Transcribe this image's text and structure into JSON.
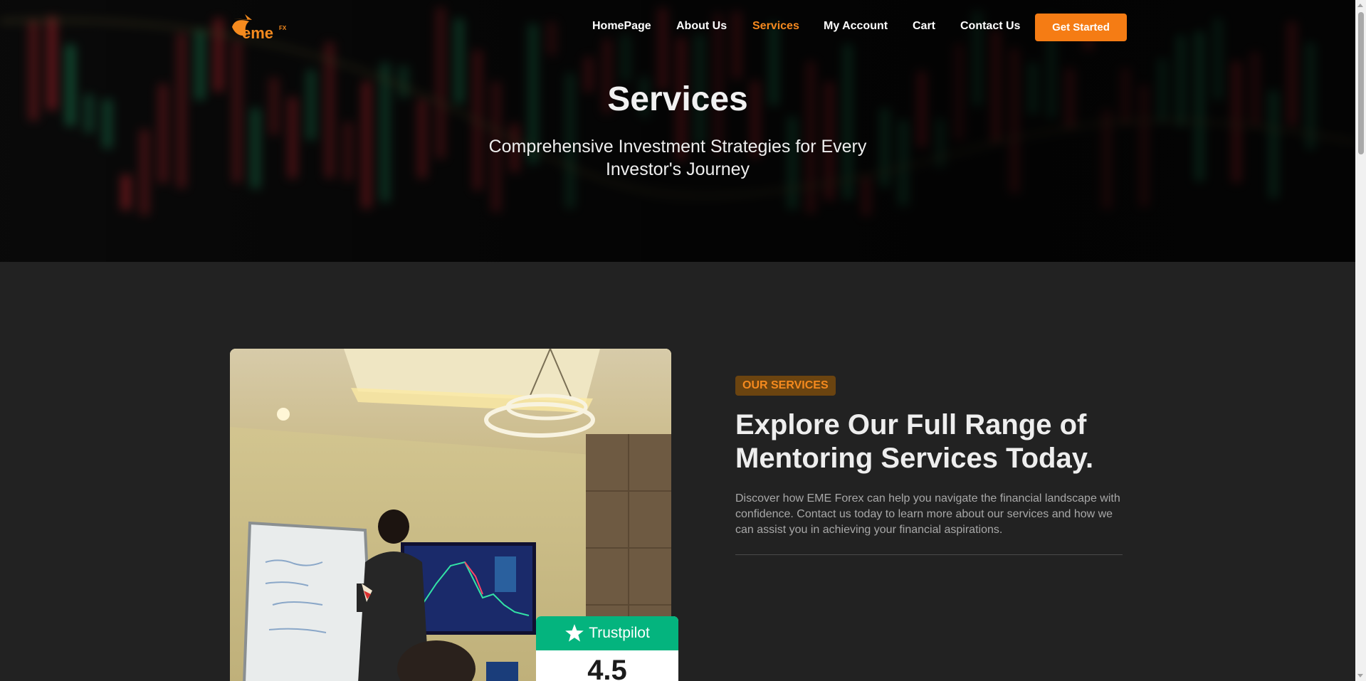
{
  "brand": {
    "logo_text": "eme",
    "logo_sup": "FX",
    "accent_color": "#f57c14"
  },
  "nav": {
    "items": [
      {
        "label": "HomePage",
        "active": false
      },
      {
        "label": "About Us",
        "active": false
      },
      {
        "label": "Services",
        "active": true
      },
      {
        "label": "My Account",
        "active": false
      },
      {
        "label": "Cart",
        "active": false
      },
      {
        "label": "Contact Us",
        "active": false
      }
    ],
    "cta_label": "Get Started"
  },
  "hero": {
    "title": "Services",
    "subtitle": "Comprehensive Investment Strategies for Every Investor's Journey"
  },
  "section": {
    "tag": "OUR SERVICES",
    "headline": "Explore Our Full Range of Mentoring Services Today.",
    "paragraph": "Discover how EME Forex can help you navigate the financial landscape with confidence. Contact us today to learn more about our services and how we can assist you in achieving your financial aspirations."
  },
  "trustpilot": {
    "name": "Trustpilot",
    "score": "4.5",
    "color": "#04b47e"
  }
}
